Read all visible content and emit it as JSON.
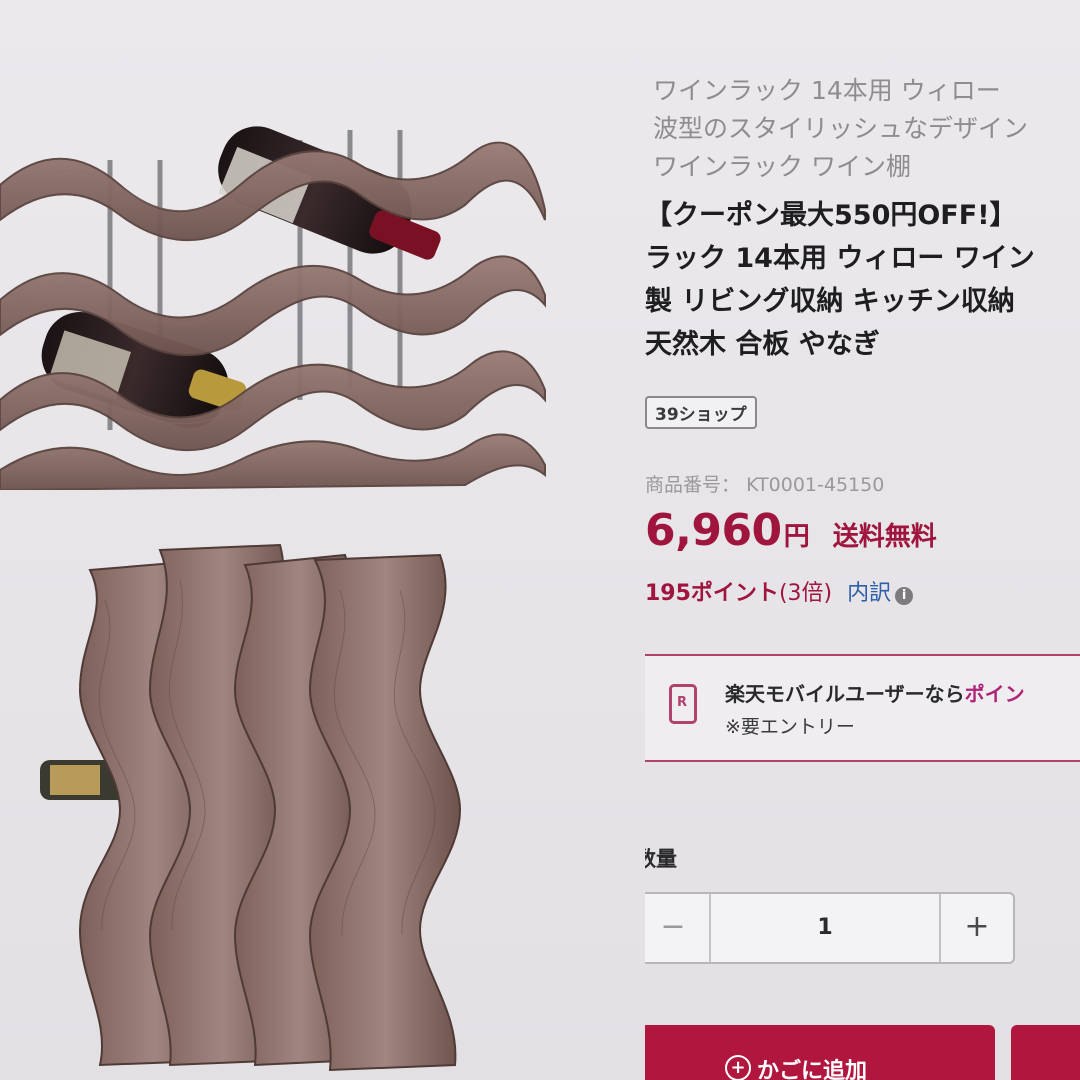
{
  "product": {
    "subtitle_lines": [
      "ワインラック 14本用 ウィロー",
      "波型のスタイリッシュなデザイン",
      "ワインラック ワイン棚"
    ],
    "title_lines": [
      "【クーポン最大550円OFF!】",
      "ラック 14本用 ウィロー ワイン",
      "製 リビング収納 キッチン収納",
      "天然木 合板 やなぎ"
    ],
    "shop_badge": "39ショップ",
    "sku_label": "商品番号：",
    "sku_value": "KT0001-45150",
    "price": "6,960",
    "price_unit": "円",
    "shipping": "送料無料",
    "points": "195ポイント",
    "points_multiplier": "(3倍)",
    "points_breakdown": "内訳",
    "info_icon": "i"
  },
  "mobile_promo": {
    "icon": "phone-r-icon",
    "icon_letter": "R",
    "text": "楽天モバイルユーザーなら",
    "highlight": "ポイン",
    "note": "※要エントリー"
  },
  "quantity": {
    "label": "数量",
    "minus": "−",
    "value": "1",
    "plus": "+"
  },
  "actions": {
    "cart_icon": "+",
    "cart_label": "かごに追加"
  },
  "colors": {
    "price": "#a0153e",
    "button": "#b1163e",
    "promo_border": "#b0426e",
    "link": "#2e5fa8"
  }
}
